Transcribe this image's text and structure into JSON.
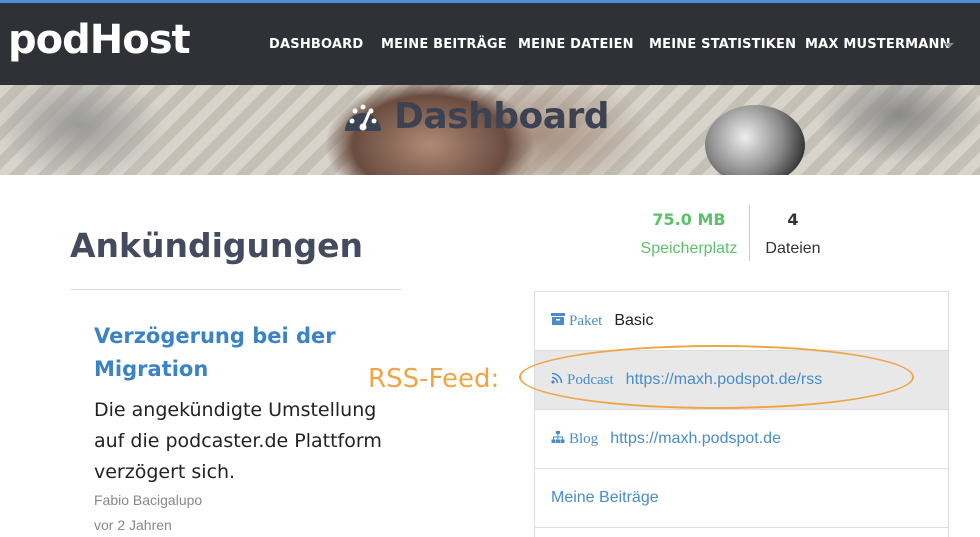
{
  "brand": {
    "logo_text": "podHost"
  },
  "nav": {
    "items": [
      "DASHBOARD",
      "MEINE BEITRÄGE",
      "MEINE DATEIEN",
      "MEINE STATISTIKEN",
      "MAX MUSTERMANN"
    ]
  },
  "banner": {
    "title": "Dashboard",
    "icon": "dashboard-gauge-icon"
  },
  "announcements": {
    "heading": "Ankündigungen",
    "items": [
      {
        "title": "Verzögerung bei der Migration",
        "body": "Die angekündigte Umstellung auf die podcaster.de Plattform verzögert sich.",
        "author": "Fabio Bacigalupo",
        "date": "vor 2 Jahren"
      }
    ]
  },
  "stats": {
    "storage_value": "75.0 MB",
    "storage_label": "Speicherplatz",
    "files_value": "4",
    "files_label": "Dateien"
  },
  "info": {
    "package_key": "Paket",
    "package_value": "Basic",
    "podcast_key": "Podcast",
    "podcast_url": "https://maxh.podspot.de/rss",
    "blog_key": "Blog",
    "blog_url": "https://maxh.podspot.de",
    "posts_link": "Meine Beiträge"
  },
  "annotation": {
    "label": "RSS-Feed:"
  },
  "colors": {
    "navbar": "#2f3136",
    "accent_link": "#3a83c4",
    "storage_green": "#5cc16a",
    "annotation_orange": "#f0a544",
    "highlight_row": "#e8e8e8"
  }
}
